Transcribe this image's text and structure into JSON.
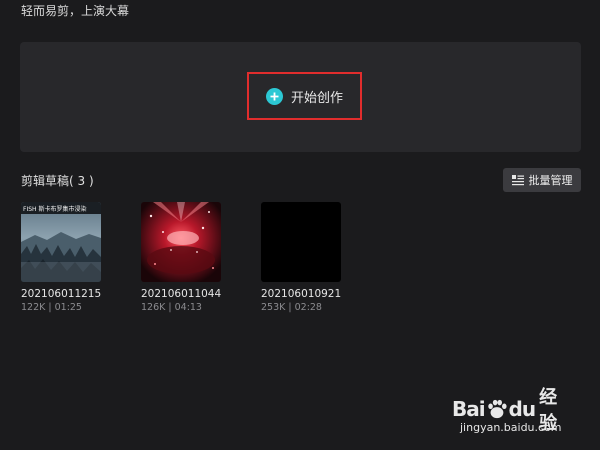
{
  "header": {
    "tagline": "轻而易剪，上演大幕"
  },
  "create": {
    "label": "开始创作",
    "highlight_color": "#e12d2d",
    "icon": "plus-circle-icon",
    "icon_color": "#2cc8d4"
  },
  "drafts": {
    "title": "剪辑草稿( 3 )",
    "batch_label": "批量管理",
    "items": [
      {
        "name": "202106011215",
        "meta": "122K | 01:25",
        "caption": "FISH 斯卡布罗集市浸染"
      },
      {
        "name": "202106011044",
        "meta": "126K | 04:13",
        "caption": ""
      },
      {
        "name": "202106010921",
        "meta": "253K | 02:28",
        "caption": ""
      }
    ]
  },
  "watermark": {
    "brand": "Bai",
    "brand_suffix": "du",
    "product": "经验",
    "url": "jingyan.baidu.com"
  }
}
